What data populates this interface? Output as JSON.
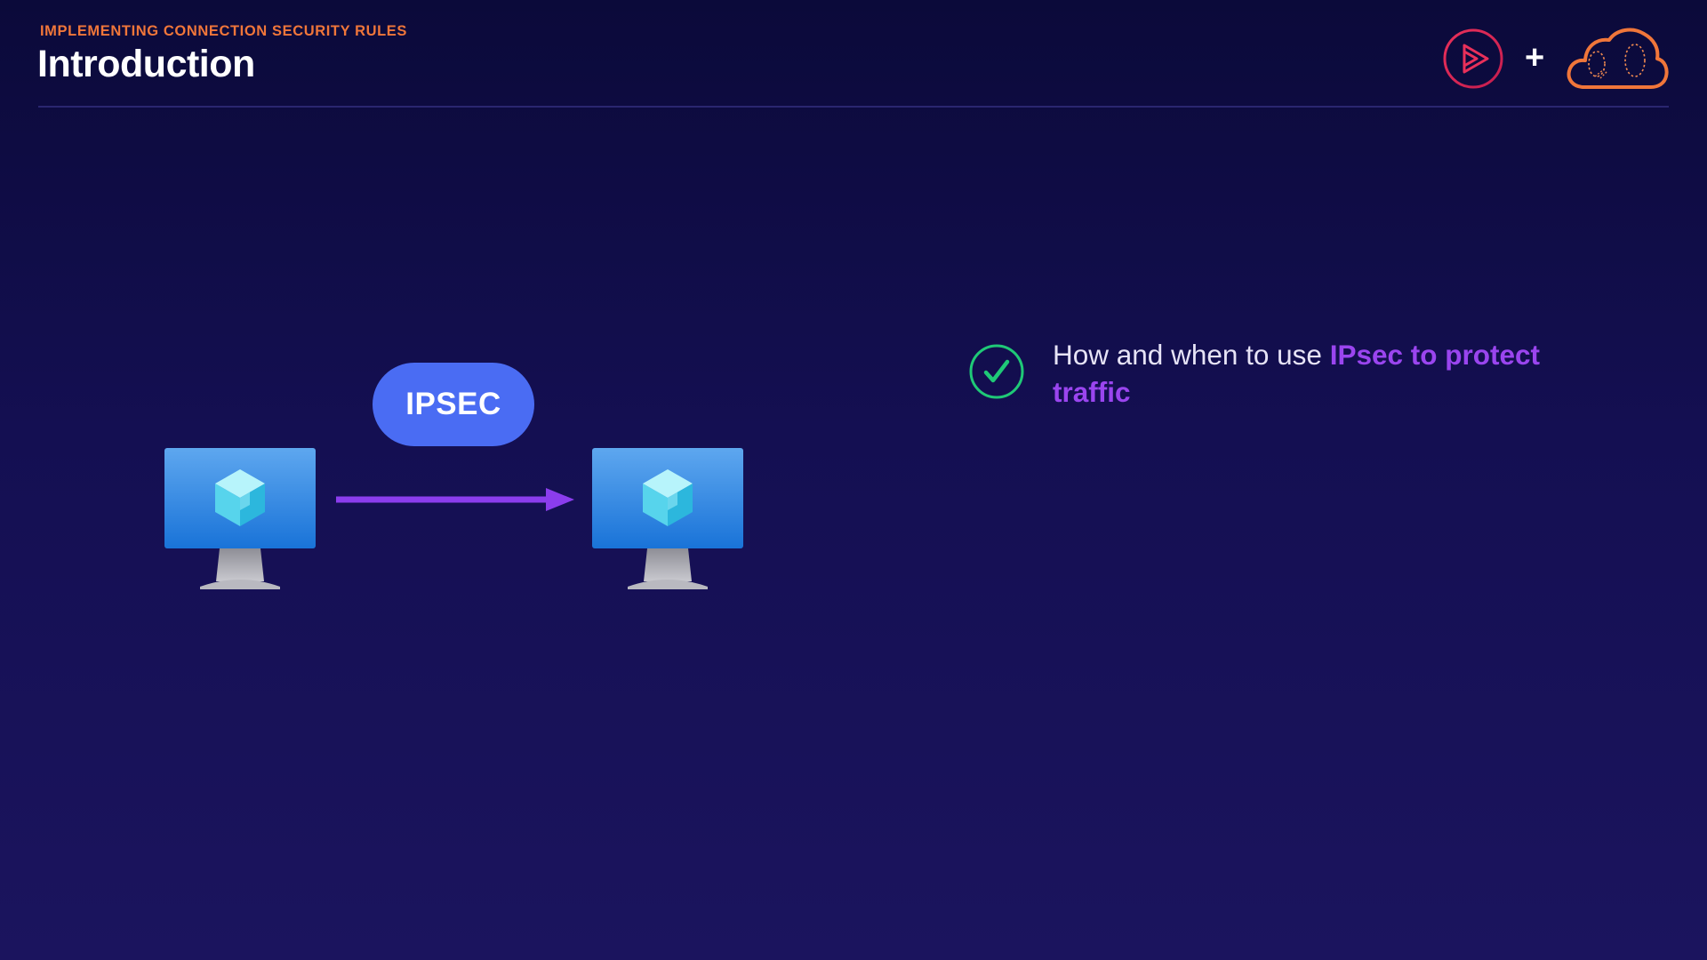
{
  "header": {
    "eyebrow": "IMPLEMENTING CONNECTION SECURITY RULES",
    "title": "Introduction"
  },
  "brand": {
    "play_icon": "play-logo-icon",
    "plus": "+",
    "cloud_icon": "cloud-logo-icon"
  },
  "diagram": {
    "source_icon": "virtual-machine-icon",
    "target_icon": "virtual-machine-icon",
    "connection_label": "IPSEC"
  },
  "bullets": [
    {
      "icon": "checkmark-circle-icon",
      "text": "How and when to use ",
      "highlight": "IPsec to protect traffic"
    }
  ],
  "colors": {
    "accent_orange": "#f0763a",
    "accent_purple": "#9a45ef",
    "pill_blue": "#4a6cf3",
    "check_green": "#1fc977",
    "logo_red": "#e0245e"
  }
}
